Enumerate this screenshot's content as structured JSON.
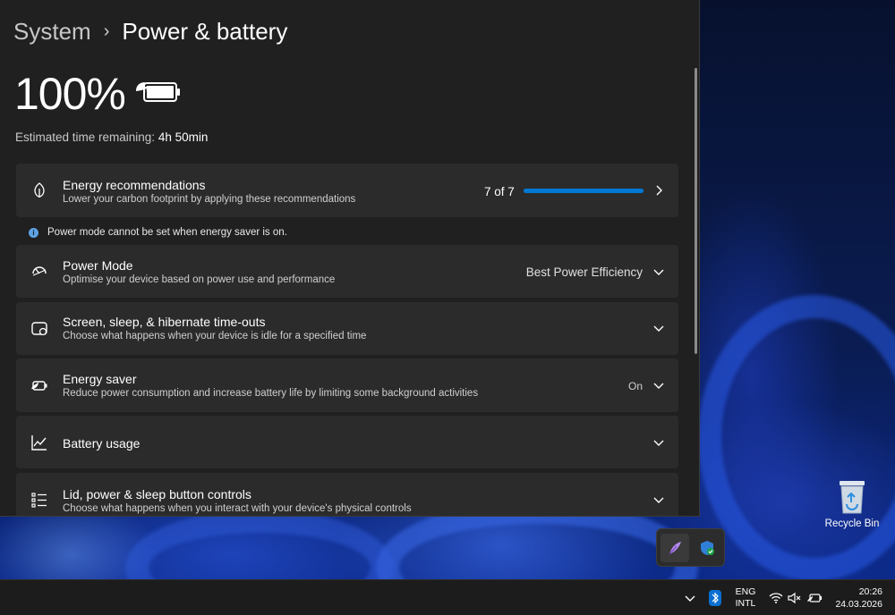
{
  "breadcrumb": {
    "parent": "System",
    "separator": "›",
    "current": "Power & battery"
  },
  "battery": {
    "percent_text": "100%",
    "estimate_label": "Estimated time remaining:",
    "estimate_value": "4h 50min"
  },
  "energy_recommendations": {
    "title": "Energy recommendations",
    "subtitle": "Lower your carbon footprint by applying these recommendations",
    "count": "7 of 7",
    "progress": 1.0
  },
  "info_message": "Power mode cannot be set when energy saver is on.",
  "power_mode": {
    "title": "Power Mode",
    "subtitle": "Optimise your device based on power use and performance",
    "value": "Best Power Efficiency"
  },
  "screen_sleep": {
    "title": "Screen, sleep, & hibernate time-outs",
    "subtitle": "Choose what happens when your device is idle for a specified time"
  },
  "energy_saver": {
    "title": "Energy saver",
    "subtitle": "Reduce power consumption and increase battery life by limiting some background activities",
    "value": "On"
  },
  "battery_usage": {
    "title": "Battery usage"
  },
  "lid_controls": {
    "title": "Lid, power & sleep button controls",
    "subtitle": "Choose what happens when you interact with your device's physical controls"
  },
  "desktop": {
    "recycle_bin_label": "Recycle Bin"
  },
  "taskbar": {
    "language_line1": "ENG",
    "language_line2": "INTL",
    "time": "20:26",
    "date": "24.03.2026"
  },
  "colors": {
    "accent": "#0078d4",
    "window_bg": "#202020",
    "card_bg": "#2b2b2b"
  },
  "icons": {
    "battery": "battery-charging-icon",
    "leaf": "leaf-icon",
    "gauge": "gauge-icon",
    "screen": "screen-sleep-icon",
    "saver": "battery-saver-icon",
    "chart": "chart-icon",
    "list": "list-icon",
    "chevron_right": "chevron-right-icon",
    "chevron_down": "chevron-down-icon"
  }
}
